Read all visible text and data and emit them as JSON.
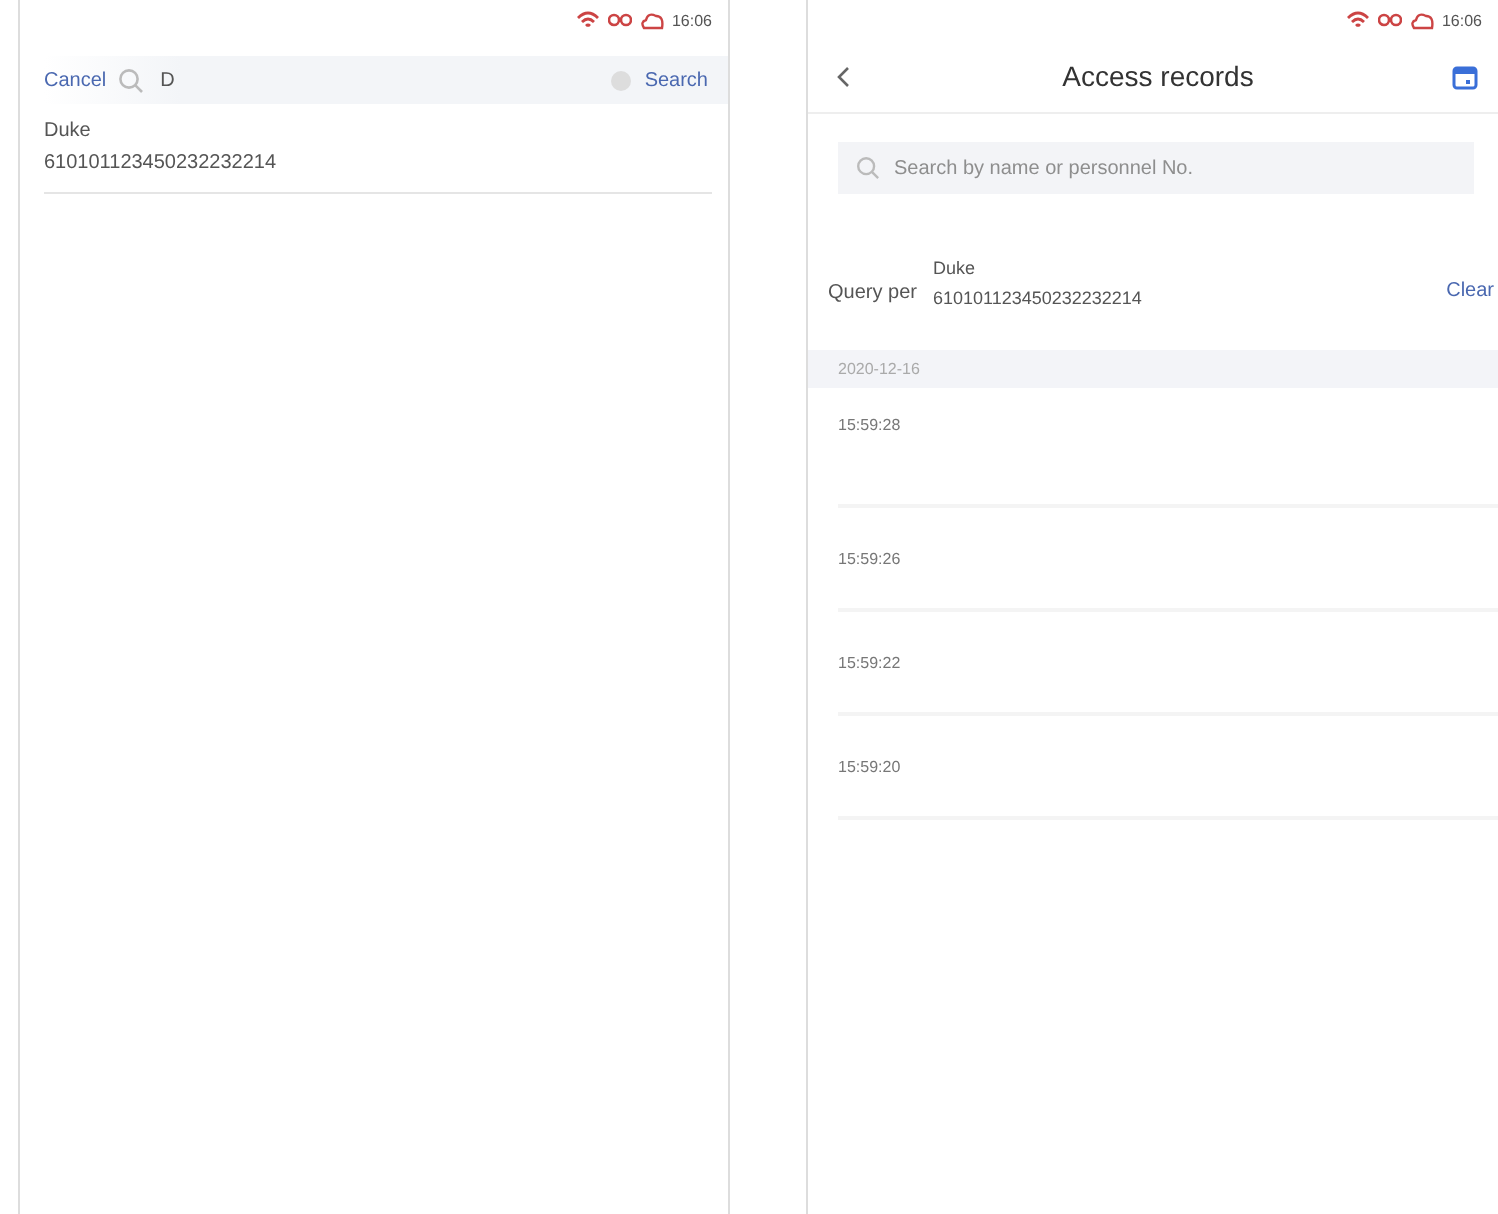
{
  "screens": [
    {
      "kind": "search",
      "status_time": "16:06",
      "cancel": "Cancel",
      "query": "D",
      "search_button": "Search",
      "results": [
        {
          "name": "Duke",
          "id": "610101123450232232214"
        }
      ]
    },
    {
      "kind": "records",
      "status_time": "16:06",
      "title": "Access records",
      "search": {
        "placeholder": "Search by name or personnel No."
      },
      "filter": {
        "label": "Query per",
        "name": "Duke",
        "id": "610101123450232232214",
        "clear": "Clear"
      },
      "date": "2020-12-16",
      "times": [
        "15:59:28",
        "15:59:26",
        "15:59:22",
        "15:59:20"
      ]
    }
  ]
}
